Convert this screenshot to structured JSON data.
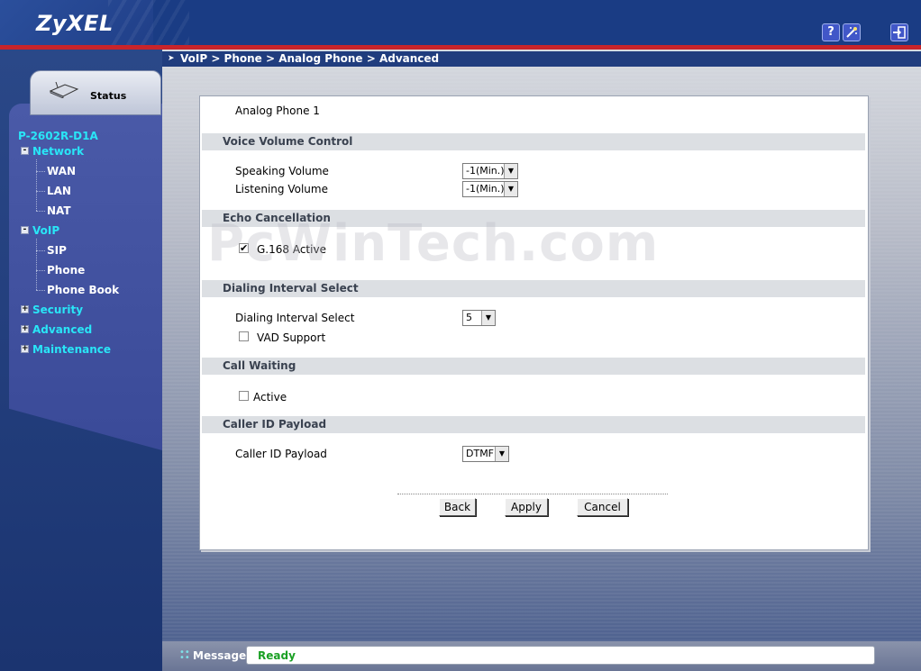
{
  "header": {
    "logo": "ZyXEL",
    "help_icon": "?",
    "wizard_icon": "wand-icon",
    "logout_icon": "logout-icon"
  },
  "sidebar": {
    "status_tab": "Status",
    "device_name": "P-2602R-D1A",
    "items": [
      {
        "label": "Network",
        "expander": "-",
        "children": [
          "WAN",
          "LAN",
          "NAT"
        ]
      },
      {
        "label": "VoIP",
        "expander": "-",
        "children": [
          "SIP",
          "Phone",
          "Phone Book"
        ]
      },
      {
        "label": "Security",
        "expander": "+"
      },
      {
        "label": "Advanced",
        "expander": "+"
      },
      {
        "label": "Maintenance",
        "expander": "+"
      }
    ]
  },
  "breadcrumb": "VoIP > Phone > Analog Phone > Advanced",
  "main": {
    "phone_title": "Analog Phone 1",
    "sections": {
      "voice_volume": "Voice Volume Control",
      "echo": "Echo Cancellation",
      "dialing": "Dialing Interval Select",
      "call_waiting": "Call Waiting",
      "caller_id": "Caller ID Payload"
    },
    "speaking_volume_label": "Speaking Volume",
    "speaking_volume_value": "-1(Min.)",
    "listening_volume_label": "Listening Volume",
    "listening_volume_value": "-1(Min.)",
    "g168_label": "G.168 Active",
    "g168_checked": "✔",
    "dialing_interval_label": "Dialing Interval Select",
    "dialing_interval_value": "5",
    "vad_label": "VAD Support",
    "call_waiting_label": "Active",
    "caller_id_label": "Caller ID Payload",
    "caller_id_value": "DTMF",
    "buttons": {
      "back": "Back",
      "apply": "Apply",
      "cancel": "Cancel"
    },
    "watermark": "PcWinTech.com"
  },
  "footer": {
    "message_label": "Message",
    "message_text": "Ready"
  },
  "colors": {
    "header": "#1a3c84",
    "red_line": "#c8242a",
    "nav_top": "#29e6f7",
    "ready": "#1aa024"
  }
}
